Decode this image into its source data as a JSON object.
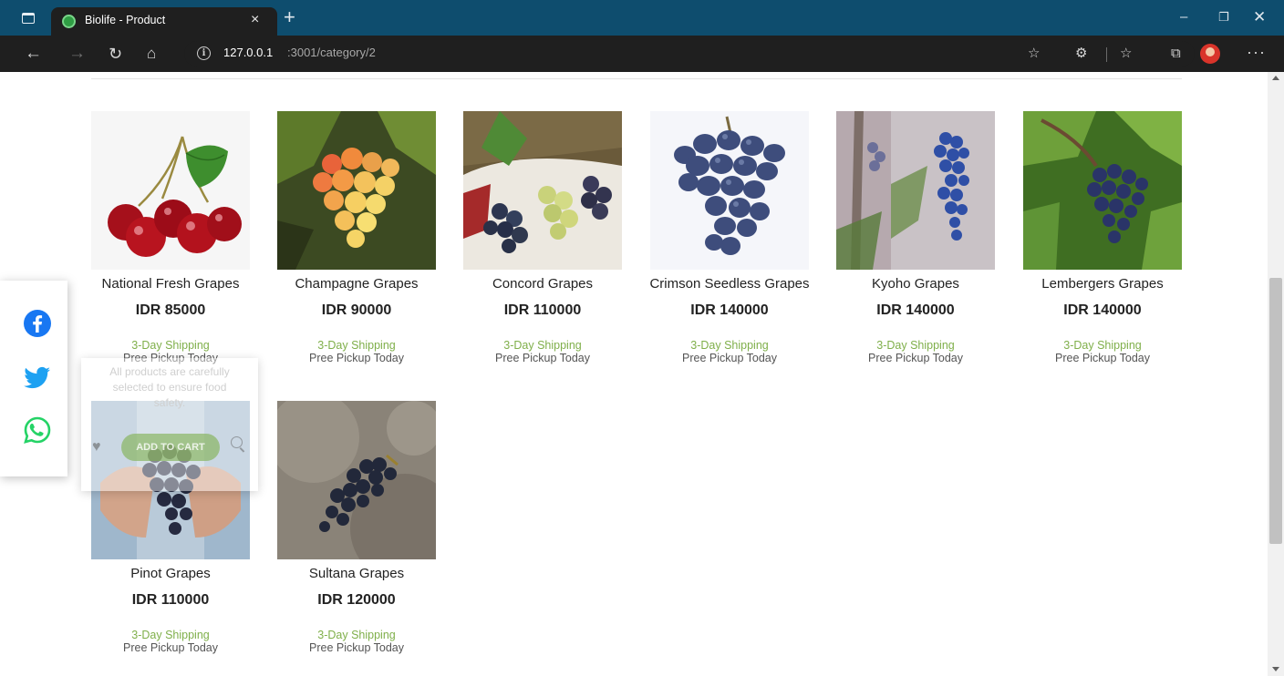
{
  "browser": {
    "tab_title": "Biolife - Product",
    "tab_close": "×",
    "new_tab": "+",
    "url_host": "127.0.0.1",
    "url_path": ":3001/category/2",
    "controls": {
      "minimize": "–",
      "restore": "❐",
      "close": "✕"
    },
    "nav": {
      "back": "←",
      "forward": "→",
      "reload": "↻",
      "home": "⌂",
      "info": "i"
    },
    "toolbar": {
      "favorite_add": "☆",
      "extensions": "⚙",
      "favorites": "☆",
      "collections": "⧉",
      "menu": "···"
    }
  },
  "products": [
    {
      "name": "National Fresh Grapes",
      "price": "IDR 85000",
      "shipping": "3-Day Shipping",
      "pickup": "Pree Pickup Today",
      "image": "cherries"
    },
    {
      "name": "Champagne Grapes",
      "price": "IDR 90000",
      "shipping": "3-Day Shipping",
      "pickup": "Pree Pickup Today",
      "image": "champagne-grapes"
    },
    {
      "name": "Concord Grapes",
      "price": "IDR 110000",
      "shipping": "3-Day Shipping",
      "pickup": "Pree Pickup Today",
      "image": "mixed-grapes-basket"
    },
    {
      "name": "Crimson Seedless Grapes",
      "price": "IDR 140000",
      "shipping": "3-Day Shipping",
      "pickup": "Pree Pickup Today",
      "image": "dark-grape-bunch"
    },
    {
      "name": "Kyoho Grapes",
      "price": "IDR 140000",
      "shipping": "3-Day Shipping",
      "pickup": "Pree Pickup Today",
      "image": "grapes-on-vine"
    },
    {
      "name": "Lembergers Grapes",
      "price": "IDR 140000",
      "shipping": "3-Day Shipping",
      "pickup": "Pree Pickup Today",
      "image": "vineyard-grapes"
    },
    {
      "name": "Pinot Grapes",
      "price": "IDR 110000",
      "shipping": "3-Day Shipping",
      "pickup": "Pree Pickup Today",
      "image": "grapes-in-hands"
    },
    {
      "name": "Sultana Grapes",
      "price": "IDR 120000",
      "shipping": "3-Day Shipping",
      "pickup": "Pree Pickup Today",
      "image": "grapes-on-stone"
    }
  ],
  "hover_card": {
    "description": "All products are carefully selected to ensure food safety.",
    "add_to_cart": "ADD TO CART",
    "heart": "♥"
  },
  "share": [
    "facebook",
    "twitter",
    "whatsapp"
  ],
  "colors": {
    "titlebar": "#0e4d6e",
    "toolbar": "#1f1f1f",
    "shipping_green": "#7faf4a",
    "facebook": "#1877f2",
    "twitter": "#1da1f2",
    "whatsapp": "#25d366"
  }
}
